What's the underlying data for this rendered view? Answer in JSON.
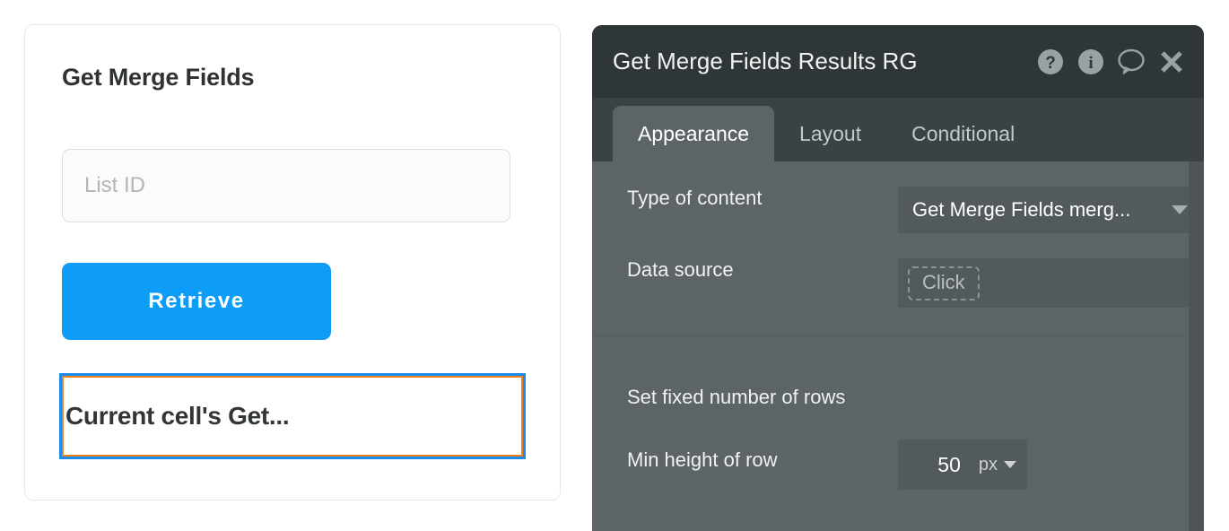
{
  "app_card": {
    "title": "Get Merge Fields",
    "list_id_input": {
      "value": "",
      "placeholder": "List ID"
    },
    "retrieve_label": "Retrieve",
    "cell_preview_text": "Current cell's Get...",
    "accent_color": "#0d9cf6",
    "selection_outer_color": "#1b8ceb",
    "selection_inner_color": "#e8821e"
  },
  "editor_panel": {
    "title": "Get Merge Fields Results RG",
    "header_icons": [
      {
        "name": "help-icon",
        "glyph": "?"
      },
      {
        "name": "info-icon",
        "glyph": "i"
      },
      {
        "name": "comment-icon",
        "glyph": "speech-bubble"
      },
      {
        "name": "close-icon",
        "glyph": "x"
      }
    ],
    "tabs": [
      {
        "label": "Appearance",
        "active": true
      },
      {
        "label": "Layout",
        "active": false
      },
      {
        "label": "Conditional",
        "active": false
      }
    ],
    "properties": {
      "type_of_content": {
        "label": "Type of content",
        "value": "Get Merge Fields merg..."
      },
      "data_source": {
        "label": "Data source",
        "value": "Click"
      },
      "set_fixed_rows": {
        "label": "Set fixed number of rows",
        "checked": false
      },
      "min_height_of_row": {
        "label": "Min height of row",
        "value": "50",
        "unit": "px"
      }
    },
    "header_bg": "#2e3638",
    "tabbar_bg": "#3a4245",
    "body_bg": "#5c6468"
  }
}
